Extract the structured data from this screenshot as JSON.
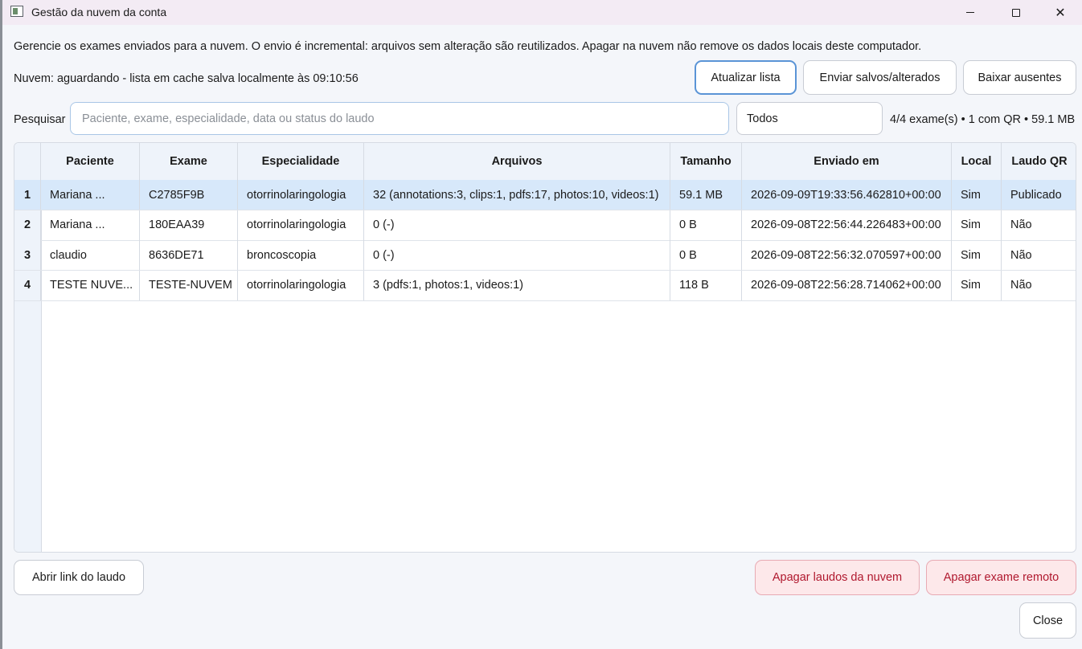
{
  "window": {
    "title": "Gestão da nuvem da conta",
    "minimize_icon": "minimize-icon",
    "maximize_icon": "maximize-icon",
    "close_icon": "close-icon",
    "close_glyph": "✕"
  },
  "description": "Gerencie os exames enviados para a nuvem. O envio é incremental: arquivos sem alteração são reutilizados. Apagar na nuvem não remove os dados locais deste computador.",
  "status_text": "Nuvem: aguardando - lista em cache salva localmente às 09:10:56",
  "toolbar": {
    "refresh_label": "Atualizar lista",
    "upload_label": "Enviar salvos/alterados",
    "download_label": "Baixar ausentes"
  },
  "search": {
    "label": "Pesquisar",
    "placeholder": "Paciente, exame, especialidade, data ou status do laudo",
    "value": ""
  },
  "filter": {
    "selected": "Todos"
  },
  "summary": "4/4 exame(s) • 1 com QR • 59.1 MB",
  "table": {
    "columns": [
      "Paciente",
      "Exame",
      "Especialidade",
      "Arquivos",
      "Tamanho",
      "Enviado em",
      "Local",
      "Laudo QR"
    ],
    "rows": [
      {
        "num": "1",
        "paciente": "Mariana ...",
        "exame": "C2785F9B",
        "especialidade": "otorrinolaringologia",
        "arquivos": "32 (annotations:3, clips:1, pdfs:17, photos:10, videos:1)",
        "tamanho": "59.1 MB",
        "enviado": "2026-09-09T19:33:56.462810+00:00",
        "local": "Sim",
        "laudo": "Publicado",
        "selected": true
      },
      {
        "num": "2",
        "paciente": "Mariana ...",
        "exame": "180EAA39",
        "especialidade": "otorrinolaringologia",
        "arquivos": "0 (-)",
        "tamanho": "0 B",
        "enviado": "2026-09-08T22:56:44.226483+00:00",
        "local": "Sim",
        "laudo": "Não",
        "selected": false
      },
      {
        "num": "3",
        "paciente": "claudio",
        "exame": "8636DE71",
        "especialidade": "broncoscopia",
        "arquivos": "0 (-)",
        "tamanho": "0 B",
        "enviado": "2026-09-08T22:56:32.070597+00:00",
        "local": "Sim",
        "laudo": "Não",
        "selected": false
      },
      {
        "num": "4",
        "paciente": "TESTE NUVE...",
        "exame": "TESTE-NUVEM",
        "especialidade": "otorrinolaringologia",
        "arquivos": "3 (pdfs:1, photos:1, videos:1)",
        "tamanho": "118 B",
        "enviado": "2026-09-08T22:56:28.714062+00:00",
        "local": "Sim",
        "laudo": "Não",
        "selected": false
      }
    ]
  },
  "footer": {
    "open_link_label": "Abrir link do laudo",
    "delete_reports_label": "Apagar laudos da nuvem",
    "delete_exam_label": "Apagar exame remoto",
    "close_label": "Close"
  }
}
